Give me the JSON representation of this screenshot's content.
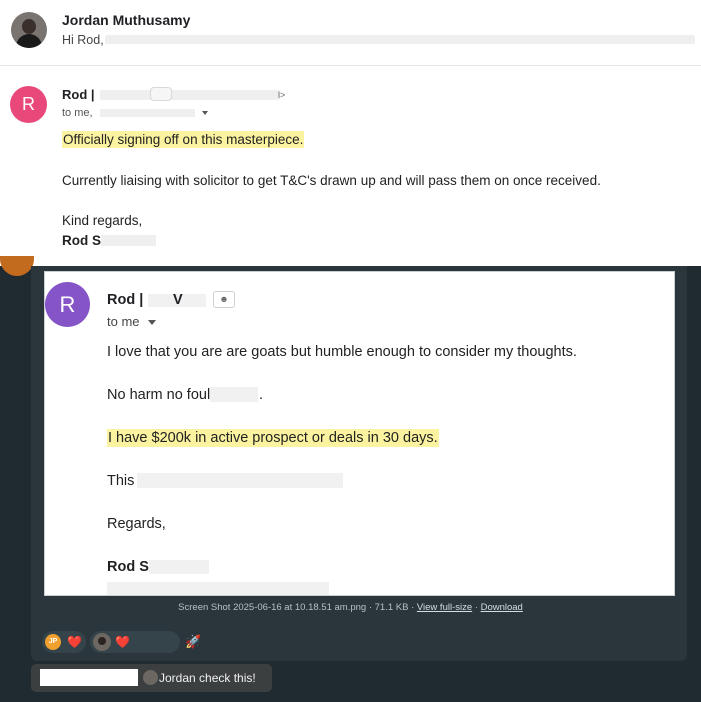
{
  "email_top": {
    "sender": "Jordan Muthusamy",
    "snippet": "Hi Rod,",
    "trailing_char": "/"
  },
  "email_reply": {
    "avatar_letter": "R",
    "avatar_color": "#e8487a",
    "from_prefix": "Rod |",
    "from_suffix": "l>",
    "to_prefix": "to me,",
    "highlighted_line": "Officially signing off on this masterpiece.",
    "body_line": "Currently liaising with solicitor to get T&C's drawn up and will pass them on once received.",
    "closing": "Kind regards,",
    "signature": "Rod S"
  },
  "chat": {
    "background": "#1f2b30",
    "attachment": {
      "screenshot": {
        "avatar_letter": "R",
        "avatar_color": "#8555c8",
        "from_prefix": "Rod |",
        "from_mid": "V",
        "to_label": "to me",
        "lines": [
          "I love that you are are goats but humble enough to consider my thoughts.",
          "No harm no foul",
          "I have $200k in active prospect or deals in 30 days.",
          "This",
          "Regards,",
          "Rod S"
        ],
        "line_2_end": "."
      },
      "caption_prefix": "Screen Shot 2025-06-16 at 10.18.51 am.png · 71.1 KB · ",
      "caption_link_view": "View full-size",
      "caption_sep": " · ",
      "caption_link_download": "Download"
    },
    "reactions": [
      {
        "avatar_initials": "JP",
        "emoji": "❤️"
      },
      {
        "emoji": "❤️"
      }
    ],
    "add_reaction_icon": "👇",
    "reply": {
      "text": "Jordan check this!"
    }
  }
}
